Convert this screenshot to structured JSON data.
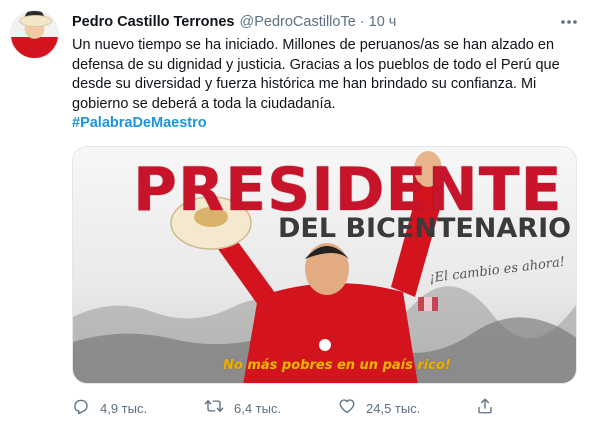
{
  "author": {
    "name": "Pedro Castillo Terrones",
    "handle": "@PedroCastilloTe",
    "separator": "·",
    "time": "10 ч"
  },
  "tweet": {
    "text": "Un nuevo tiempo se ha iniciado. Millones de peruanos/as se han alzado en defensa de su dignidad y justicia. Gracias a los pueblos de todo el Perú que desde su diversidad y fuerza histórica me han brindado su confianza. Mi gobierno se deberá a toda la ciudadanía.",
    "hashtag": "#PalabraDeMaestro"
  },
  "media": {
    "headline": "PRESIDENTE",
    "subheadline": "DEL BICENTENARIO",
    "slogan": "¡El cambio es ahora!",
    "bottom_caption": "No más pobres en un país rico!",
    "shirt_brand": "Perú"
  },
  "actions": {
    "replies": "4,9 тыс.",
    "retweets": "6,4 тыс.",
    "likes": "24,5 тыс."
  },
  "colors": {
    "link": "#1b95e0",
    "muted": "#5b7083",
    "brand_red": "#c8142b"
  },
  "icons": [
    "more-icon",
    "reply-icon",
    "retweet-icon",
    "like-icon",
    "share-icon"
  ]
}
